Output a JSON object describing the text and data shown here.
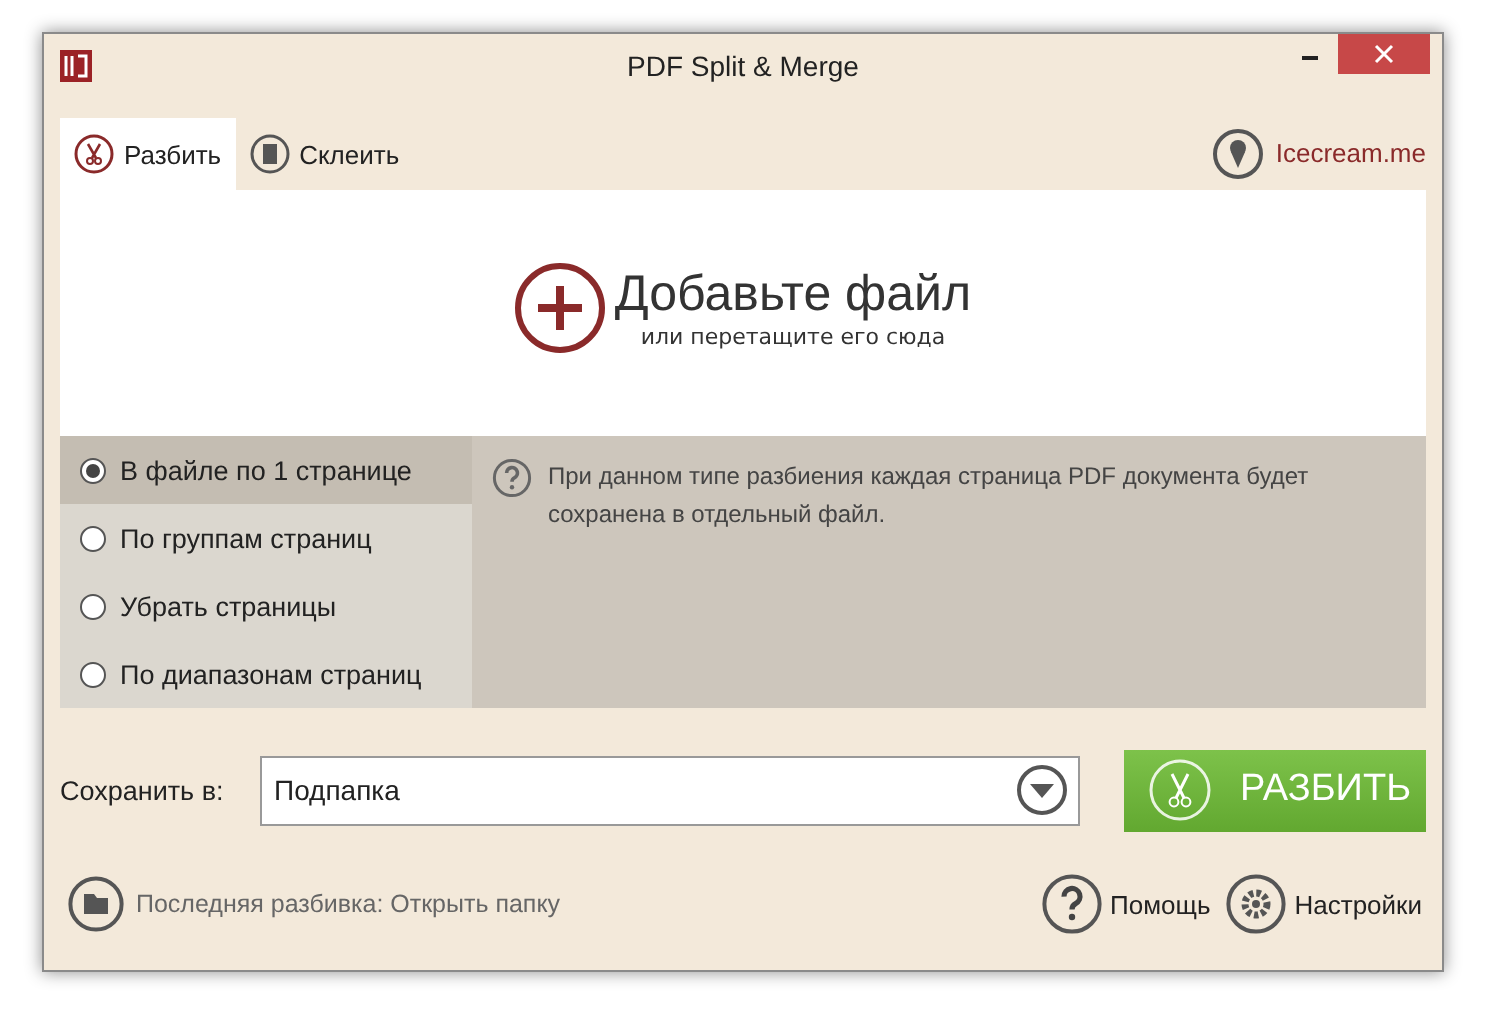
{
  "window": {
    "title": "PDF Split & Merge"
  },
  "tabs": [
    {
      "label": "Разбить",
      "kind": "split",
      "selected": true
    },
    {
      "label": "Склеить",
      "kind": "merge",
      "selected": false
    }
  ],
  "brand_link": "Icecream.me",
  "drop_zone": {
    "title": "Добавьте файл",
    "subtitle": "или перетащите его сюда"
  },
  "split_modes": [
    {
      "label": "В файле по 1 странице",
      "selected": true
    },
    {
      "label": "По группам страниц",
      "selected": false
    },
    {
      "label": "Убрать страницы",
      "selected": false
    },
    {
      "label": "По диапазонам страниц",
      "selected": false
    }
  ],
  "mode_hint": "При данном типе разбиения каждая страница PDF документа будет сохранена в отдельный файл.",
  "save_to": {
    "label": "Сохранить в:",
    "value": "Подпапка"
  },
  "split_button": "РАЗБИТЬ",
  "footer": {
    "last_split": "Последняя разбивка: Открыть папку",
    "help": "Помощь",
    "settings": "Настройки"
  }
}
